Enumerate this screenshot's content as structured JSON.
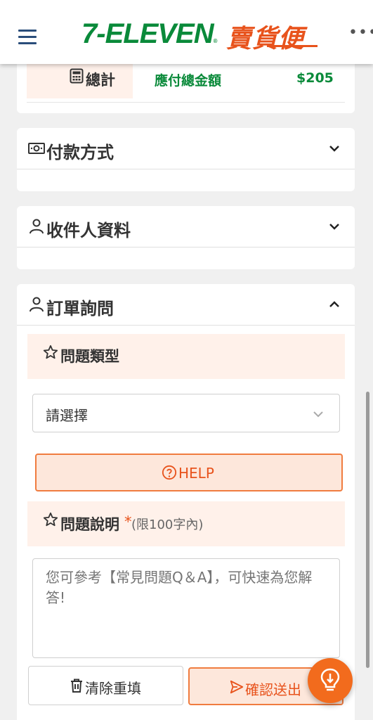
{
  "header": {
    "logo_711": "7-ELEVEN",
    "logo_reg": "®",
    "logo_service": "賣貨便",
    "menu_icon": "hamburger-icon",
    "more_icon": "more-dots-icon",
    "more_glyph": "•••"
  },
  "summary": {
    "label": "總計",
    "amount_label": "應付總金額",
    "amount_value": "$205"
  },
  "sections": {
    "payment": {
      "title": "付款方式",
      "icon": "money-icon",
      "expanded": false
    },
    "recipient": {
      "title": "收件人資料",
      "icon": "person-icon",
      "expanded": false
    },
    "inquiry": {
      "title": "訂單詢問",
      "icon": "person-icon",
      "expanded": true
    }
  },
  "inquiry": {
    "type_label": "問題類型",
    "type_select_value": "請選擇",
    "help_label": "HELP",
    "desc_label": "問題說明",
    "desc_required": "*",
    "desc_limit": "(限100字內)",
    "desc_placeholder": "您可參考【常見問題Q＆A】，可快速為您解答!",
    "clear_label": "清除重填",
    "submit_label": "確認送出"
  },
  "colors": {
    "brand_green": "#0a8a3a",
    "brand_orange": "#e8531c",
    "accent_peach": "#fff1ea",
    "fab_orange": "#f26b1d"
  }
}
